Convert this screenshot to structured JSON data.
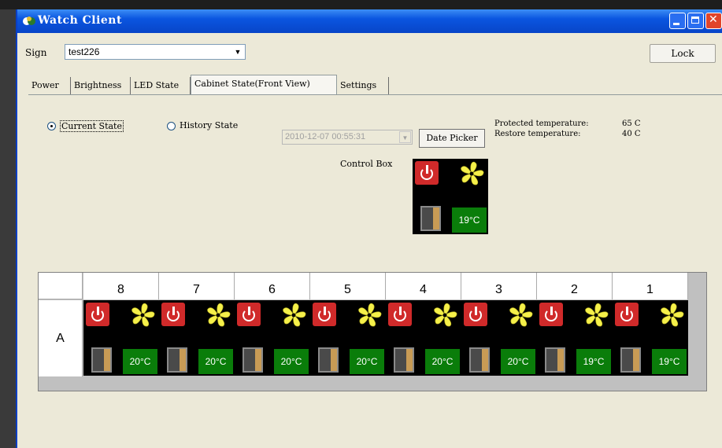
{
  "window": {
    "title": "Watch Client"
  },
  "sign": {
    "label": "Sign",
    "value": "test226"
  },
  "lock_label": "Lock",
  "tabs": [
    {
      "label": "Power"
    },
    {
      "label": "Brightness"
    },
    {
      "label": "LED State"
    },
    {
      "label": "Cabinet State(Front View)"
    },
    {
      "label": "Settings"
    }
  ],
  "active_tab": "Cabinet State(Front View)",
  "state": {
    "current_label": "Current State",
    "current_selected": true,
    "history_label": "History State",
    "history_datetime": "2010-12-07 00:55:31",
    "date_picker_label": "Date Picker",
    "protected_label": "Protected temperature:",
    "protected_value": "65 C",
    "restore_label": "Restore temperature:",
    "restore_value": "40 C"
  },
  "control_box": {
    "label": "Control Box",
    "temp": "19°C"
  },
  "grid": {
    "row_label": "A",
    "columns": [
      {
        "label": "8",
        "temp": "20°C"
      },
      {
        "label": "7",
        "temp": "20°C"
      },
      {
        "label": "6",
        "temp": "20°C"
      },
      {
        "label": "5",
        "temp": "20°C"
      },
      {
        "label": "4",
        "temp": "20°C"
      },
      {
        "label": "3",
        "temp": "20°C"
      },
      {
        "label": "2",
        "temp": "19°C"
      },
      {
        "label": "1",
        "temp": "19°C"
      }
    ]
  },
  "colors": {
    "titlebar": "#0a55e0",
    "temp_bg": "#0a7d0a",
    "power": "#d02a2a",
    "fan": "#f5f04a"
  }
}
